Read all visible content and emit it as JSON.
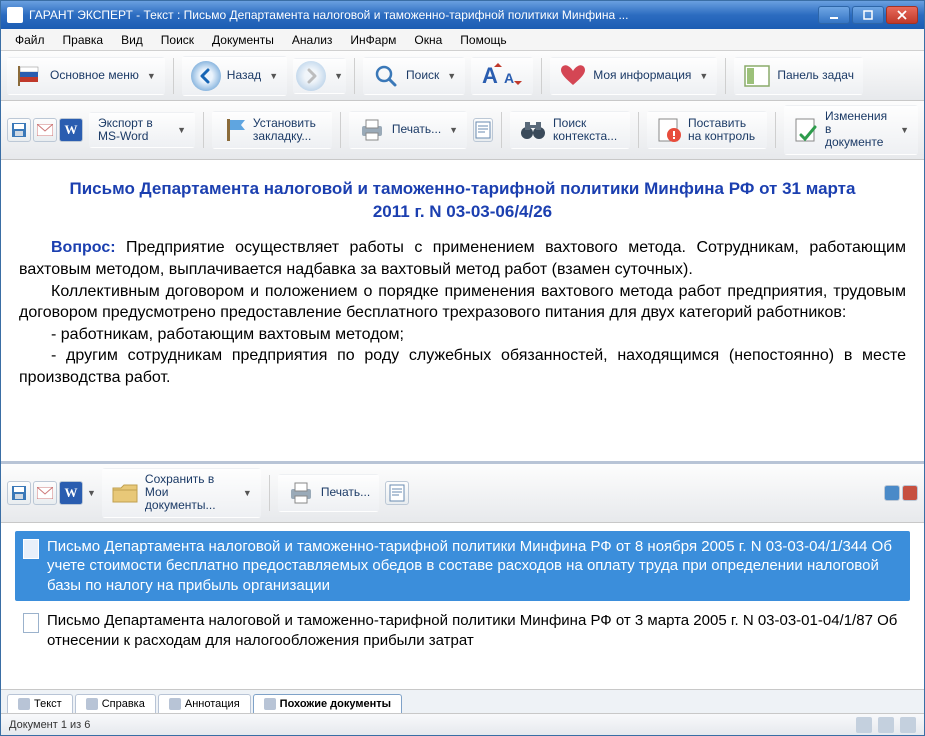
{
  "window": {
    "title": "ГАРАНТ ЭКСПЕРТ - Текст : Письмо Департамента налоговой и таможенно-тарифной политики Минфина ..."
  },
  "menu": [
    "Файл",
    "Правка",
    "Вид",
    "Поиск",
    "Документы",
    "Анализ",
    "ИнФарм",
    "Окна",
    "Помощь"
  ],
  "toolbar1": {
    "main_menu": "Основное меню",
    "back": "Назад",
    "search": "Поиск",
    "my_info": "Моя информация",
    "task_panel": "Панель задач"
  },
  "toolbar2": {
    "export": "Экспорт в MS-Word",
    "bookmark": "Установить закладку...",
    "print": "Печать...",
    "ctx_search": "Поиск контекста...",
    "control": "Поставить на контроль",
    "changes": "Изменения в документе"
  },
  "document": {
    "title": "Письмо Департамента налоговой и таможенно-тарифной политики Минфина РФ от 31 марта 2011 г. N 03-03-06/4/26",
    "question_label": "Вопрос:",
    "para1": "Предприятие осуществляет работы с применением вахтового метода. Сотрудникам, работающим вахтовым методом, выплачивается надбавка за вахтовый метод работ (взамен суточных).",
    "para2": "Коллективным договором и положением о порядке применения вахтового метода работ предприятия, трудовым договором предусмотрено предоставление бесплатного трехразового питания для двух категорий работников:",
    "bullet1": "- работникам, работающим вахтовым методом;",
    "bullet2": "- другим сотрудникам предприятия по роду служебных обязанностей, находящимся (непостоянно) в месте производства работ."
  },
  "bottom_toolbar": {
    "save_docs": "Сохранить в Мои документы...",
    "print": "Печать..."
  },
  "results": [
    {
      "text": "Письмо Департамента налоговой и таможенно-тарифной политики Минфина РФ от 8 ноября 2005 г. N 03-03-04/1/344 Об учете стоимости бесплатно предоставляемых обедов в составе расходов на оплату труда при определении налоговой базы по налогу на прибыль организации",
      "selected": true
    },
    {
      "text": "Письмо Департамента налоговой и таможенно-тарифной политики Минфина РФ от 3 марта 2005 г. N 03-03-01-04/1/87 Об отнесении к расходам для налогообложения прибыли затрат",
      "selected": false
    }
  ],
  "tabs": [
    "Текст",
    "Справка",
    "Аннотация",
    "Похожие документы"
  ],
  "active_tab_index": 3,
  "status": {
    "text": "Документ 1 из 6"
  }
}
